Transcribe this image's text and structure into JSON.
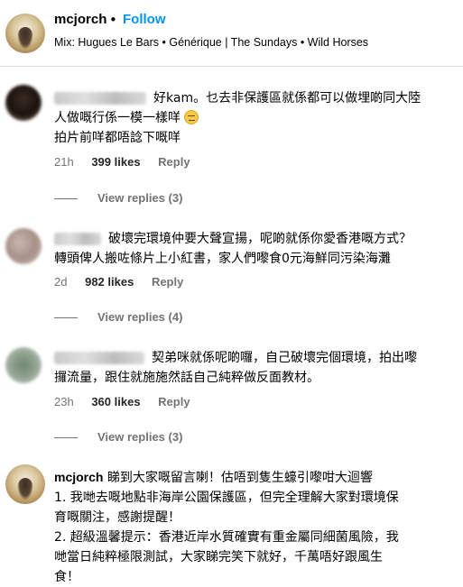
{
  "header": {
    "username": "mcjorch",
    "separator": "•",
    "follow_label": "Follow",
    "audio": "Mix: Hugues Le Bars • Générique | The Sundays • Wild Horses"
  },
  "comments": [
    {
      "text_line1": "好kam。乜去非保護區就係都可以做埋啲同大陸",
      "text_line2": "人做嘅行係一模一樣咩",
      "text_line3": "拍片前咩都唔諗下嘅咩",
      "emoji_icon": "grimacing-face-emoji",
      "time": "21h",
      "likes": "399 likes",
      "reply": "Reply",
      "view_replies": "View replies (3)"
    },
    {
      "text_line1": "破壞完環境仲要大聲宣揚，呢啲就係你愛香港嘅方式？",
      "text_line2": "轉頭俾人搬咗條片上小紅書，家人們嚟食0元海鮮同污染海灘",
      "time": "2d",
      "likes": "982 likes",
      "reply": "Reply",
      "view_replies": "View replies (4)"
    },
    {
      "text_line1": "契弟咪就係呢啲囉，自己破壞完個環境，拍出嚟",
      "text_line2": "攞流量，跟住就施施然話自己純粹做反面教材。",
      "time": "23h",
      "likes": "360 likes",
      "reply": "Reply",
      "view_replies": "View replies (3)"
    },
    {
      "username": "mcjorch",
      "text_line1": "睇到大家嘅留言喇！估唔到隻生蠔引嚟咁大迴響",
      "text_line2": "1. 我哋去嘅地點非海岸公園保護區，但完全理解大家對環境保",
      "text_line3": "育嘅關注，感謝提醒！",
      "text_line4": "2. 超級溫馨提示：香港近岸水質確實有重金屬同細菌風險，我",
      "text_line5": "哋當日純粹極限測試，大家睇完笑下就好，千萬唔好跟風生",
      "text_line6": "食！"
    }
  ]
}
